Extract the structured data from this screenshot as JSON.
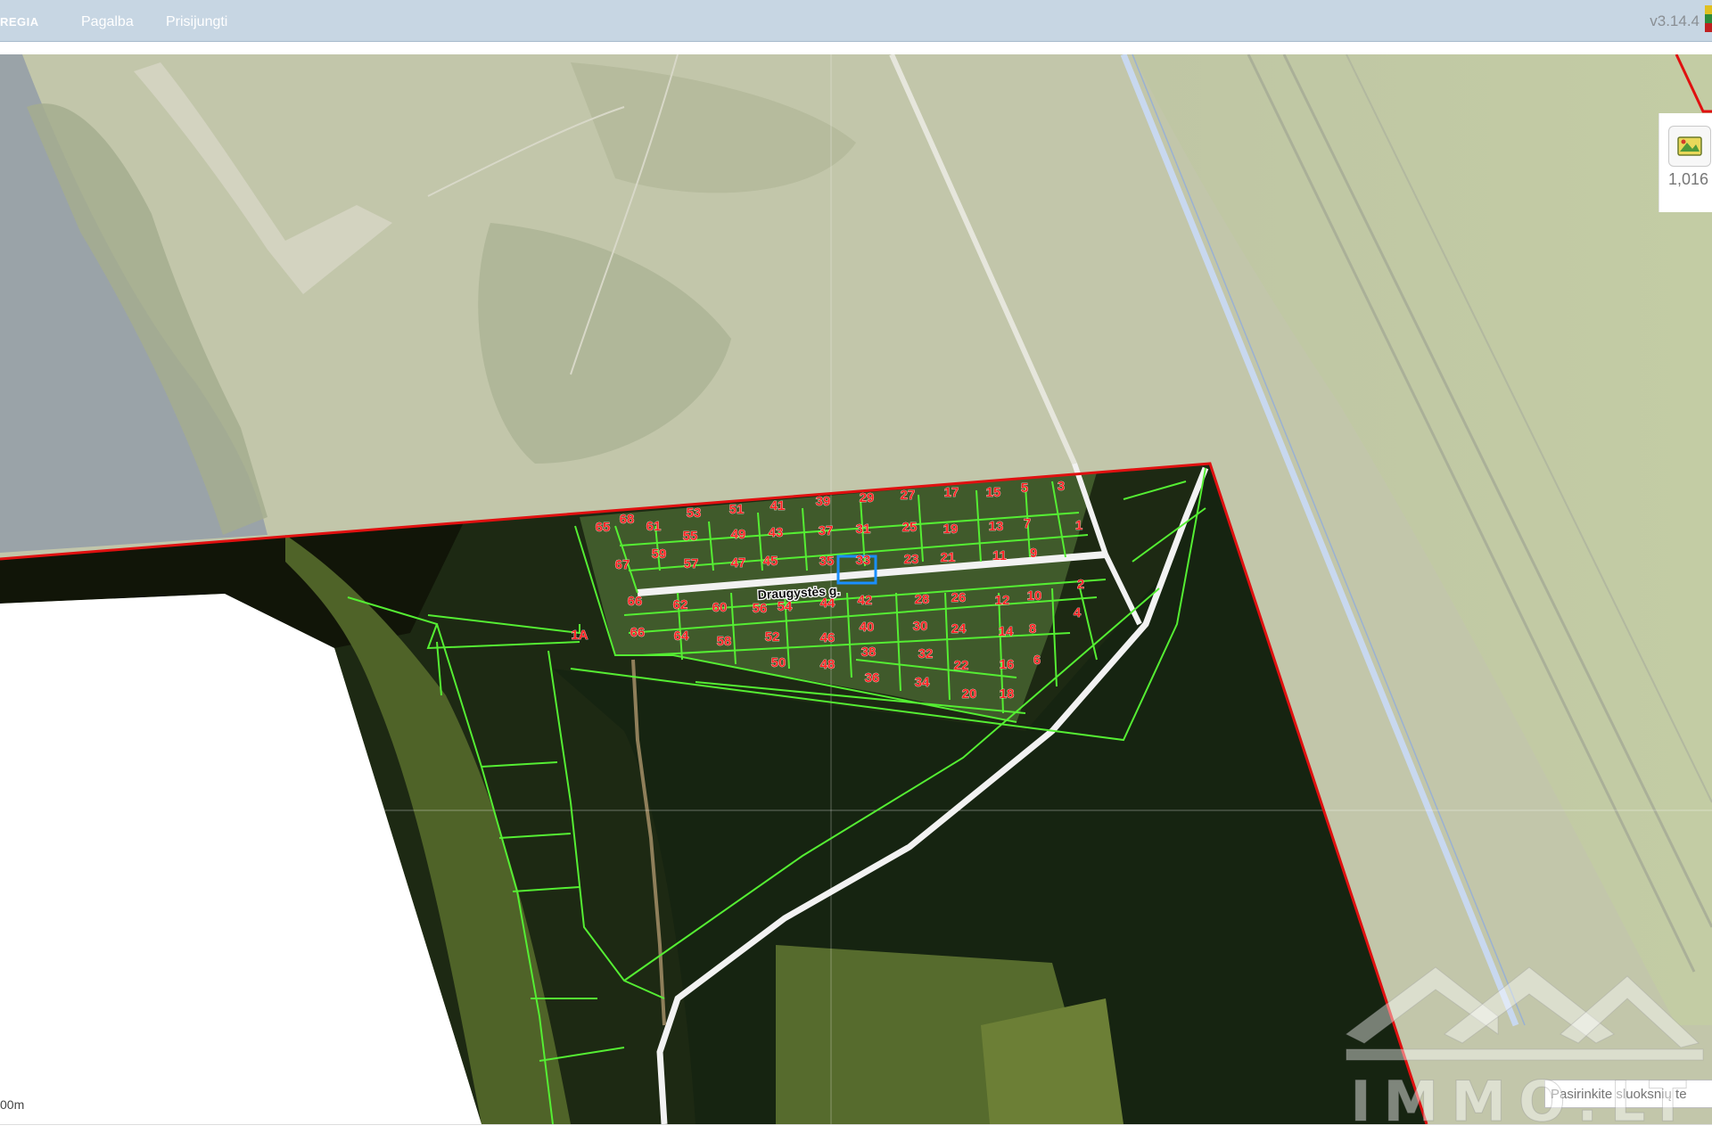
{
  "header": {
    "brand": "REGIA",
    "menu": [
      {
        "label": "Pagalba"
      },
      {
        "label": "Prisijungti"
      }
    ],
    "version": "v3.14.4"
  },
  "map": {
    "street_label": "Draugystės g.",
    "scale_label": "00m",
    "layer_count": "1,016",
    "layer_search_placeholder": "Pasirinkite sluoksnių te",
    "highlighted_parcel": "33",
    "parcel_labels": [
      "68",
      "53",
      "51",
      "41",
      "39",
      "29",
      "27",
      "17",
      "15",
      "5",
      "3",
      "65",
      "61",
      "55",
      "49",
      "43",
      "37",
      "31",
      "25",
      "19",
      "13",
      "7",
      "1",
      "67",
      "59",
      "57",
      "47",
      "45",
      "35",
      "33",
      "23",
      "21",
      "11",
      "9",
      "2",
      "66",
      "62",
      "60",
      "56",
      "54",
      "44",
      "42",
      "28",
      "26",
      "12",
      "10",
      "4",
      "1A",
      "66",
      "64",
      "58",
      "52",
      "46",
      "40",
      "30",
      "24",
      "14",
      "8",
      "50",
      "48",
      "38",
      "32",
      "22",
      "16",
      "6",
      "36",
      "34",
      "20",
      "18"
    ]
  },
  "watermark": {
    "text": "IMMO.LT"
  },
  "colors": {
    "parcel_lines": "#55ee33",
    "label_red": "#ff2222",
    "boundary_red": "#e01010",
    "selection_blue": "#1a8fff"
  }
}
